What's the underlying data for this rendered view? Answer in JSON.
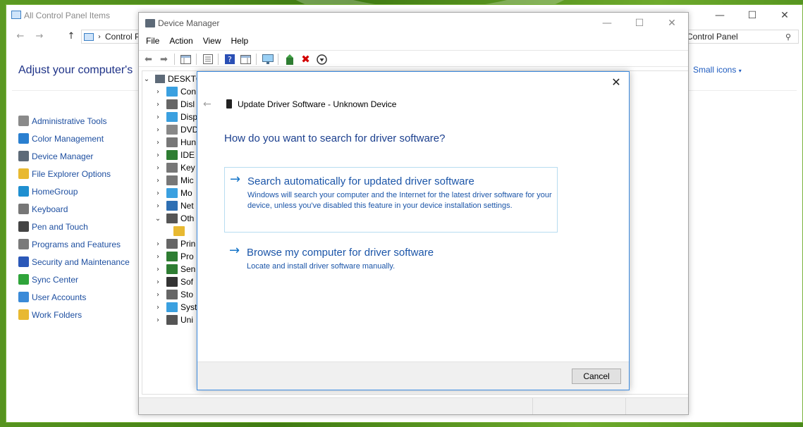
{
  "control_panel": {
    "title": "All Control Panel Items",
    "breadcrumb": "Control P",
    "search_text": "Control Panel",
    "heading": "Adjust your computer's",
    "view_by": "Small icons",
    "items": [
      {
        "label": "Administrative Tools",
        "icon": "admin-tools-icon",
        "color": "#8a8a8a"
      },
      {
        "label": "Color Management",
        "icon": "color-management-icon",
        "color": "#2a7fd0"
      },
      {
        "label": "Device Manager",
        "icon": "device-manager-icon",
        "color": "#5d6a78"
      },
      {
        "label": "File Explorer Options",
        "icon": "folder-icon",
        "color": "#e8b931"
      },
      {
        "label": "HomeGroup",
        "icon": "homegroup-icon",
        "color": "#1f8fd0"
      },
      {
        "label": "Keyboard",
        "icon": "keyboard-icon",
        "color": "#777777"
      },
      {
        "label": "Pen and Touch",
        "icon": "pen-icon",
        "color": "#444444"
      },
      {
        "label": "Programs and Features",
        "icon": "programs-icon",
        "color": "#7a7a7a"
      },
      {
        "label": "Security and Maintenance",
        "icon": "flag-icon",
        "color": "#2b58b8"
      },
      {
        "label": "Sync Center",
        "icon": "sync-icon",
        "color": "#2fa43a"
      },
      {
        "label": "User Accounts",
        "icon": "user-icon",
        "color": "#3a8ad8"
      },
      {
        "label": "Work Folders",
        "icon": "work-folders-icon",
        "color": "#e8b931"
      }
    ]
  },
  "device_manager": {
    "title": "Device Manager",
    "menu": [
      "File",
      "Action",
      "View",
      "Help"
    ],
    "tree": {
      "root": "DESKTC",
      "rows": [
        {
          "label": "Con",
          "expander": "›",
          "icon_color": "#3aa0e0"
        },
        {
          "label": "Disl",
          "expander": "›",
          "icon_color": "#666666"
        },
        {
          "label": "Disp",
          "expander": "›",
          "icon_color": "#3aa0e0"
        },
        {
          "label": "DVD",
          "expander": "›",
          "icon_color": "#888888"
        },
        {
          "label": "Hun",
          "expander": "›",
          "icon_color": "#777777"
        },
        {
          "label": "IDE",
          "expander": "›",
          "icon_color": "#2e7d32"
        },
        {
          "label": "Key",
          "expander": "›",
          "icon_color": "#777777"
        },
        {
          "label": "Mic",
          "expander": "›",
          "icon_color": "#777777"
        },
        {
          "label": "Mo",
          "expander": "›",
          "icon_color": "#3aa0e0"
        },
        {
          "label": "Net",
          "expander": "›",
          "icon_color": "#2e6fb3"
        },
        {
          "label": "Oth",
          "expander": "⌄",
          "icon_color": "#555555"
        },
        {
          "label": "",
          "expander": "",
          "icon_color": "#e8b931"
        },
        {
          "label": "Prin",
          "expander": "›",
          "icon_color": "#666666"
        },
        {
          "label": "Pro",
          "expander": "›",
          "icon_color": "#2e7d32"
        },
        {
          "label": "Sen",
          "expander": "›",
          "icon_color": "#2e7d32"
        },
        {
          "label": "Sof",
          "expander": "›",
          "icon_color": "#333333"
        },
        {
          "label": "Sto",
          "expander": "›",
          "icon_color": "#666666"
        },
        {
          "label": "Syst",
          "expander": "›",
          "icon_color": "#3aa0e0"
        },
        {
          "label": "Uni",
          "expander": "›",
          "icon_color": "#555555"
        }
      ]
    }
  },
  "dialog": {
    "title": "Update Driver Software - Unknown Device",
    "question": "How do you want to search for driver software?",
    "options": [
      {
        "heading": "Search automatically for updated driver software",
        "description": "Windows will search your computer and the Internet for the latest driver software for your device, unless you've disabled this feature in your device installation settings."
      },
      {
        "heading": "Browse my computer for driver software",
        "description": "Locate and install driver software manually."
      }
    ],
    "cancel_label": "Cancel"
  },
  "colors": {
    "accent": "#1474c8",
    "heading_blue": "#1b3f8e",
    "link_blue": "#1e4fa0",
    "dialog_border": "#3c8be0",
    "desktop_green": "#4f8a1c"
  }
}
